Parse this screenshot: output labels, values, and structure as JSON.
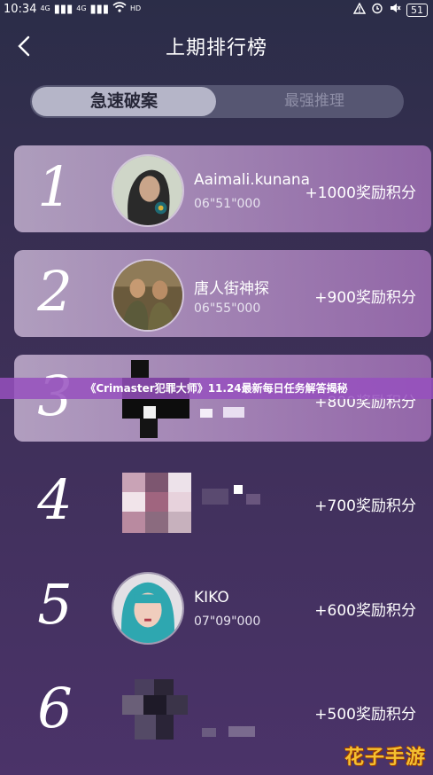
{
  "status_bar": {
    "time": "10:34",
    "signal1": "4G",
    "signal2": "4G",
    "network": "HD",
    "battery": "51"
  },
  "header": {
    "title": "上期排行榜"
  },
  "tabs": [
    {
      "label": "急速破案",
      "active": true
    },
    {
      "label": "最强推理",
      "active": false
    }
  ],
  "rankings": [
    {
      "rank": "1",
      "name": "Aaimali.kunana",
      "time": "06\"51\"000",
      "reward": "+1000奖励积分"
    },
    {
      "rank": "2",
      "name": "唐人街神探",
      "time": "06\"55\"000",
      "reward": "+900奖励积分"
    },
    {
      "rank": "3",
      "name": "",
      "time": "",
      "reward": "+800奖励积分"
    },
    {
      "rank": "4",
      "name": "",
      "time": "",
      "reward": "+700奖励积分"
    },
    {
      "rank": "5",
      "name": "KIKO",
      "time": "07\"09\"000",
      "reward": "+600奖励积分"
    },
    {
      "rank": "6",
      "name": "",
      "time": "",
      "reward": "+500奖励积分"
    }
  ],
  "banner": "《Crimaster犯罪大师》11.24最新每日任务解答揭秘",
  "watermark": "花子手游",
  "colors": {
    "background_top": "#2b2d48",
    "background_bottom": "#4b3369",
    "card_highlight": "#c8a8d8",
    "banner": "#9650be",
    "watermark": "#f5c030"
  }
}
